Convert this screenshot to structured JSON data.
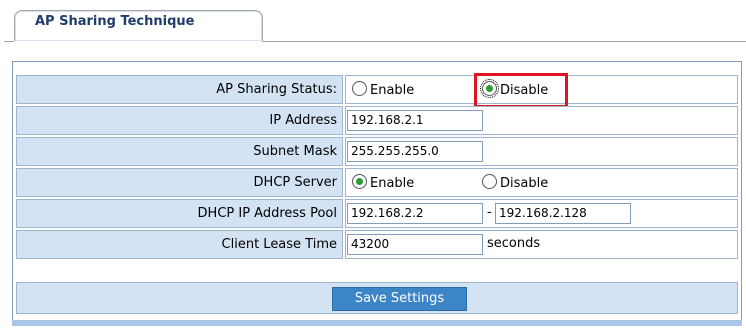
{
  "tab": {
    "title": "AP Sharing Technique"
  },
  "form": {
    "ap_sharing_status": {
      "label": "AP Sharing Status:",
      "options": [
        {
          "label": "Enable",
          "selected": false
        },
        {
          "label": "Disable",
          "selected": true
        }
      ]
    },
    "ip_address": {
      "label": "IP Address",
      "value": "192.168.2.1"
    },
    "subnet_mask": {
      "label": "Subnet Mask",
      "value": "255.255.255.0"
    },
    "dhcp_server": {
      "label": "DHCP Server",
      "options": [
        {
          "label": "Enable",
          "selected": true
        },
        {
          "label": "Disable",
          "selected": false
        }
      ]
    },
    "dhcp_pool": {
      "label": "DHCP IP Address Pool",
      "start": "192.168.2.2",
      "separator": "-",
      "end": "192.168.2.128"
    },
    "client_lease_time": {
      "label": "Client Lease Time",
      "value": "43200",
      "unit": "seconds"
    },
    "save_button": {
      "label": "Save Settings"
    }
  },
  "colors": {
    "label_bg": "#d4e3f3",
    "button_bg": "#3c86c8",
    "highlight": "#e0141e",
    "radio_dot": "#2d9c2d"
  }
}
